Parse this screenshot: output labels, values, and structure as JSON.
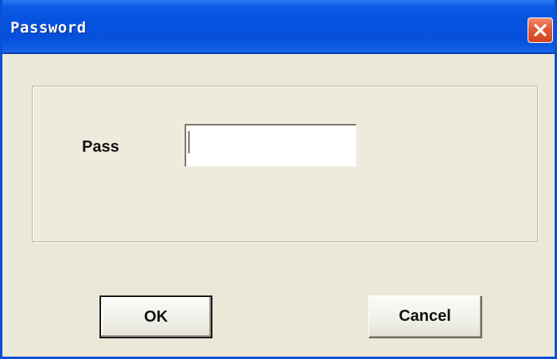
{
  "window": {
    "title": "Password",
    "close_label": "Close"
  },
  "form": {
    "label": "Pass",
    "password_value": "",
    "password_placeholder": ""
  },
  "buttons": {
    "ok_label": "OK",
    "cancel_label": "Cancel"
  },
  "colors": {
    "titlebar": "#0552de",
    "close_button": "#e05a36",
    "dialog_background": "#ebe8d9"
  },
  "icons": {
    "close": "close-icon"
  }
}
